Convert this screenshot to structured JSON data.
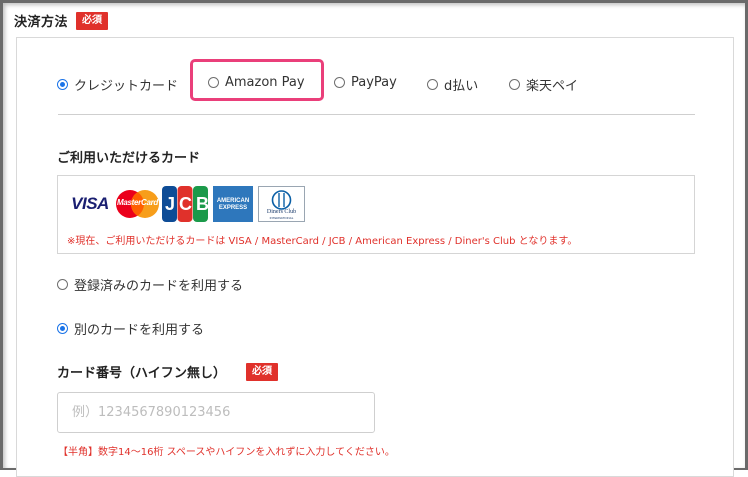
{
  "section": {
    "title": "決済方法",
    "required_badge": "必須"
  },
  "payment_methods": [
    {
      "label": "クレジットカード",
      "selected": true
    },
    {
      "label": "Amazon Pay",
      "selected": false,
      "highlighted": true
    },
    {
      "label": "PayPay",
      "selected": false
    },
    {
      "label": "d払い",
      "selected": false
    },
    {
      "label": "楽天ペイ",
      "selected": false
    }
  ],
  "available_cards": {
    "heading": "ご利用いただけるカード",
    "logos": {
      "visa": "VISA",
      "mastercard": "MasterCard",
      "jcb": "JCB",
      "amex_line1": "AMERICAN",
      "amex_line2": "EXPRESS",
      "diners_line1": "Diners Club",
      "diners_line2": "INTERNATIONAL"
    },
    "note": "※現在、ご利用いただけるカードは VISA / MasterCard / JCB / American Express / Diner's Club となります。"
  },
  "card_choice": {
    "saved": {
      "label": "登録済みのカードを利用する",
      "selected": false
    },
    "new": {
      "label": "別のカードを利用する",
      "selected": true
    }
  },
  "card_number": {
    "label": "カード番号（ハイフン無し）",
    "required_badge": "必須",
    "placeholder": "例）1234567890123456",
    "value": "",
    "note": "【半角】数字14〜16桁 スペースやハイフンを入れずに入力してください。"
  },
  "colors": {
    "required_badge": "#e0312b",
    "highlight": "#ea3f7a",
    "radio_selected": "#1a73e8"
  }
}
